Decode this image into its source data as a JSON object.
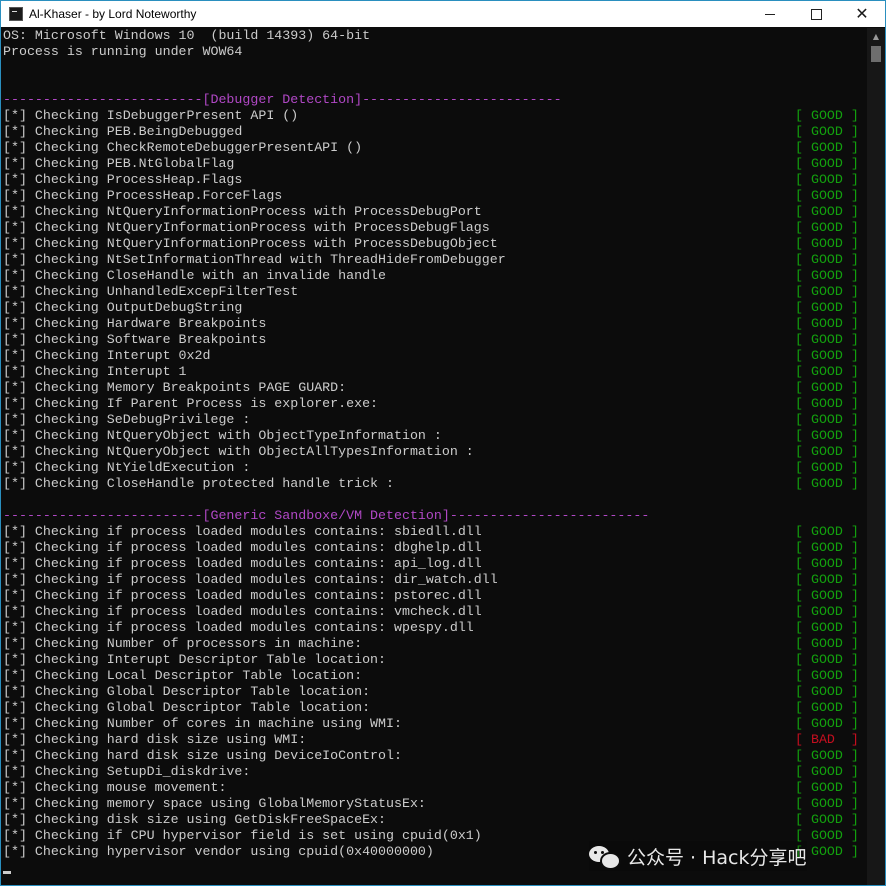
{
  "window": {
    "title": "Al-Khaser - by Lord Noteworthy",
    "icon": "console-app-icon",
    "controls": {
      "minimize": "minimize-icon",
      "maximize": "maximize-icon",
      "close": "✕"
    }
  },
  "colors": {
    "background": "#0c0c0c",
    "text": "#cccccc",
    "good": "#13a10e",
    "bad": "#c50f1f",
    "header": "#b148c6"
  },
  "console": {
    "lines": [
      {
        "text": "OS: Microsoft Windows 10  (build 14393) 64-bit"
      },
      {
        "text": "Process is running under WOW64"
      },
      {
        "text": ""
      },
      {
        "text": ""
      },
      {
        "text": "-------------------------[Debugger Detection]-------------------------",
        "kind": "header"
      },
      {
        "text": "[*] Checking IsDebuggerPresent API ()",
        "status": "[ GOOD ]",
        "result": "good"
      },
      {
        "text": "[*] Checking PEB.BeingDebugged",
        "status": "[ GOOD ]",
        "result": "good"
      },
      {
        "text": "[*] Checking CheckRemoteDebuggerPresentAPI ()",
        "status": "[ GOOD ]",
        "result": "good"
      },
      {
        "text": "[*] Checking PEB.NtGlobalFlag",
        "status": "[ GOOD ]",
        "result": "good"
      },
      {
        "text": "[*] Checking ProcessHeap.Flags",
        "status": "[ GOOD ]",
        "result": "good"
      },
      {
        "text": "[*] Checking ProcessHeap.ForceFlags",
        "status": "[ GOOD ]",
        "result": "good"
      },
      {
        "text": "[*] Checking NtQueryInformationProcess with ProcessDebugPort",
        "status": "[ GOOD ]",
        "result": "good"
      },
      {
        "text": "[*] Checking NtQueryInformationProcess with ProcessDebugFlags",
        "status": "[ GOOD ]",
        "result": "good"
      },
      {
        "text": "[*] Checking NtQueryInformationProcess with ProcessDebugObject",
        "status": "[ GOOD ]",
        "result": "good"
      },
      {
        "text": "[*] Checking NtSetInformationThread with ThreadHideFromDebugger",
        "status": "[ GOOD ]",
        "result": "good"
      },
      {
        "text": "[*] Checking CloseHandle with an invalide handle",
        "status": "[ GOOD ]",
        "result": "good"
      },
      {
        "text": "[*] Checking UnhandledExcepFilterTest",
        "status": "[ GOOD ]",
        "result": "good"
      },
      {
        "text": "[*] Checking OutputDebugString",
        "status": "[ GOOD ]",
        "result": "good"
      },
      {
        "text": "[*] Checking Hardware Breakpoints",
        "status": "[ GOOD ]",
        "result": "good"
      },
      {
        "text": "[*] Checking Software Breakpoints",
        "status": "[ GOOD ]",
        "result": "good"
      },
      {
        "text": "[*] Checking Interupt 0x2d",
        "status": "[ GOOD ]",
        "result": "good"
      },
      {
        "text": "[*] Checking Interupt 1",
        "status": "[ GOOD ]",
        "result": "good"
      },
      {
        "text": "[*] Checking Memory Breakpoints PAGE GUARD:",
        "status": "[ GOOD ]",
        "result": "good"
      },
      {
        "text": "[*] Checking If Parent Process is explorer.exe:",
        "status": "[ GOOD ]",
        "result": "good"
      },
      {
        "text": "[*] Checking SeDebugPrivilege :",
        "status": "[ GOOD ]",
        "result": "good"
      },
      {
        "text": "[*] Checking NtQueryObject with ObjectTypeInformation :",
        "status": "[ GOOD ]",
        "result": "good"
      },
      {
        "text": "[*] Checking NtQueryObject with ObjectAllTypesInformation :",
        "status": "[ GOOD ]",
        "result": "good"
      },
      {
        "text": "[*] Checking NtYieldExecution :",
        "status": "[ GOOD ]",
        "result": "good"
      },
      {
        "text": "[*] Checking CloseHandle protected handle trick :",
        "status": "[ GOOD ]",
        "result": "good"
      },
      {
        "text": ""
      },
      {
        "text": "-------------------------[Generic Sandboxe/VM Detection]-------------------------",
        "kind": "header"
      },
      {
        "text": "[*] Checking if process loaded modules contains: sbiedll.dll",
        "status": "[ GOOD ]",
        "result": "good"
      },
      {
        "text": "[*] Checking if process loaded modules contains: dbghelp.dll",
        "status": "[ GOOD ]",
        "result": "good"
      },
      {
        "text": "[*] Checking if process loaded modules contains: api_log.dll",
        "status": "[ GOOD ]",
        "result": "good"
      },
      {
        "text": "[*] Checking if process loaded modules contains: dir_watch.dll",
        "status": "[ GOOD ]",
        "result": "good"
      },
      {
        "text": "[*] Checking if process loaded modules contains: pstorec.dll",
        "status": "[ GOOD ]",
        "result": "good"
      },
      {
        "text": "[*] Checking if process loaded modules contains: vmcheck.dll",
        "status": "[ GOOD ]",
        "result": "good"
      },
      {
        "text": "[*] Checking if process loaded modules contains: wpespy.dll",
        "status": "[ GOOD ]",
        "result": "good"
      },
      {
        "text": "[*] Checking Number of processors in machine:",
        "status": "[ GOOD ]",
        "result": "good"
      },
      {
        "text": "[*] Checking Interupt Descriptor Table location:",
        "status": "[ GOOD ]",
        "result": "good"
      },
      {
        "text": "[*] Checking Local Descriptor Table location:",
        "status": "[ GOOD ]",
        "result": "good"
      },
      {
        "text": "[*] Checking Global Descriptor Table location:",
        "status": "[ GOOD ]",
        "result": "good"
      },
      {
        "text": "[*] Checking Global Descriptor Table location:",
        "status": "[ GOOD ]",
        "result": "good"
      },
      {
        "text": "[*] Checking Number of cores in machine using WMI:",
        "status": "[ GOOD ]",
        "result": "good"
      },
      {
        "text": "[*] Checking hard disk size using WMI:",
        "status": "[ BAD  ]",
        "result": "bad"
      },
      {
        "text": "[*] Checking hard disk size using DeviceIoControl:",
        "status": "[ GOOD ]",
        "result": "good"
      },
      {
        "text": "[*] Checking SetupDi_diskdrive:",
        "status": "[ GOOD ]",
        "result": "good"
      },
      {
        "text": "[*] Checking mouse movement:",
        "status": "[ GOOD ]",
        "result": "good"
      },
      {
        "text": "[*] Checking memory space using GlobalMemoryStatusEx:",
        "status": "[ GOOD ]",
        "result": "good"
      },
      {
        "text": "[*] Checking disk size using GetDiskFreeSpaceEx:",
        "status": "[ GOOD ]",
        "result": "good"
      },
      {
        "text": "[*] Checking if CPU hypervisor field is set using cpuid(0x1)",
        "status": "[ GOOD ]",
        "result": "good"
      },
      {
        "text": "[*] Checking hypervisor vendor using cpuid(0x40000000)",
        "status": "[ GOOD ]",
        "result": "good"
      }
    ]
  },
  "watermark": {
    "icon": "wechat-icon",
    "text": "公众号 · Hack分享吧"
  }
}
